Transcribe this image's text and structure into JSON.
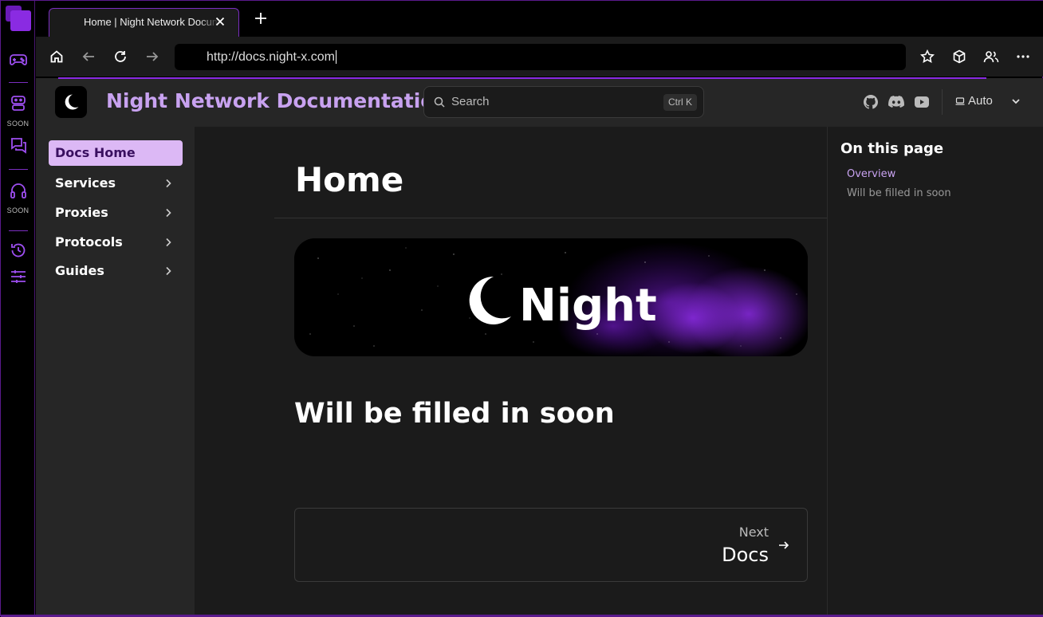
{
  "browser": {
    "tab_title": "Home | Night Network Documentation",
    "new_tab_label": "+",
    "url": "http://docs.night-x.com",
    "rail": {
      "soon_1": "SOON",
      "soon_2": "SOON"
    }
  },
  "site": {
    "title": "Night Network Documentation",
    "search_placeholder": "Search",
    "search_shortcut": "Ctrl K",
    "theme_label": "Auto"
  },
  "sidebar": {
    "items": [
      {
        "label": "Docs Home"
      },
      {
        "label": "Services"
      },
      {
        "label": "Proxies"
      },
      {
        "label": "Protocols"
      },
      {
        "label": "Guides"
      }
    ]
  },
  "main": {
    "heading": "Home",
    "banner_text": "Night",
    "subheading": "Will be filled in soon",
    "next": {
      "small": "Next",
      "big": "Docs"
    }
  },
  "toc": {
    "title": "On this page",
    "links": [
      {
        "label": "Overview"
      },
      {
        "label": "Will be filled in soon"
      }
    ]
  },
  "colors": {
    "accent": "#8a2be2",
    "title_purple": "#c8a2f0",
    "active_item_bg": "#dcb8f5"
  }
}
